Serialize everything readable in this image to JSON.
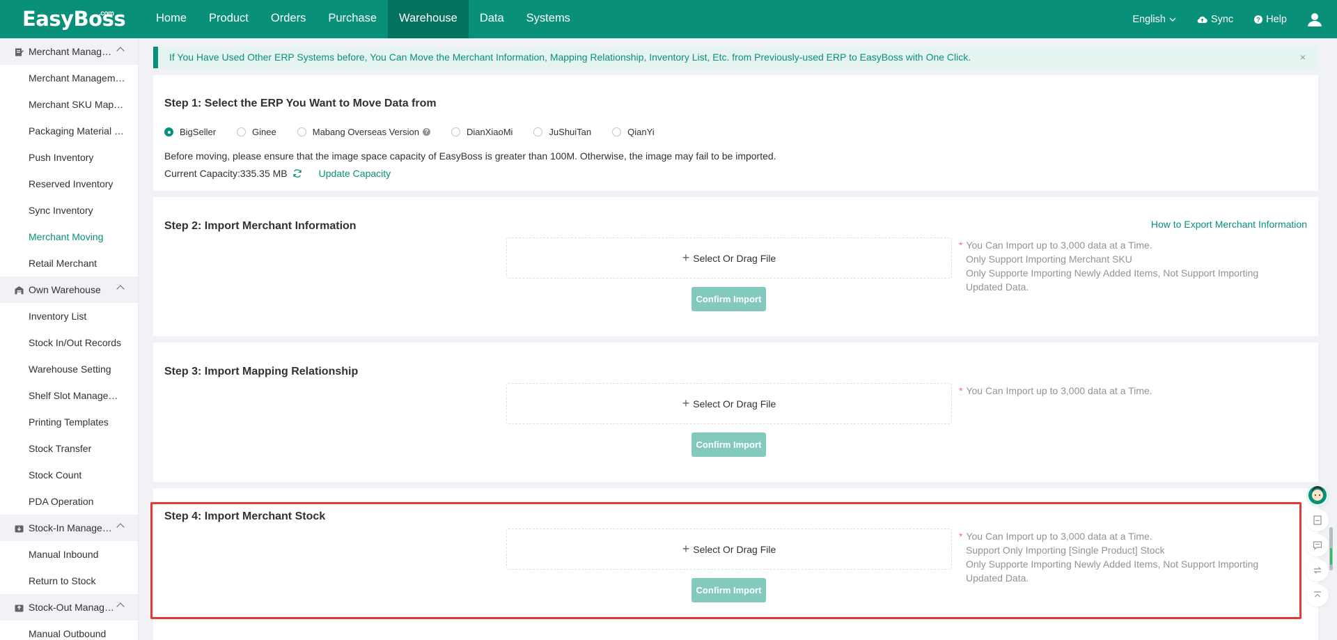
{
  "header": {
    "logo": "EasyBoss",
    "logo_suffix": ".com",
    "nav": [
      {
        "label": "Home"
      },
      {
        "label": "Product"
      },
      {
        "label": "Orders"
      },
      {
        "label": "Purchase"
      },
      {
        "label": "Warehouse",
        "active": true
      },
      {
        "label": "Data"
      },
      {
        "label": "Systems"
      }
    ],
    "language": "English",
    "sync": "Sync",
    "help": "Help"
  },
  "sidebar": {
    "groups": [
      {
        "label": "Merchant Management",
        "items": [
          "Merchant Management",
          "Merchant SKU Mapping",
          "Packaging Material Management",
          "Push Inventory",
          "Reserved Inventory",
          "Sync Inventory",
          "Merchant Moving",
          "Retail Merchant"
        ]
      },
      {
        "label": "Own Warehouse",
        "items": [
          "Inventory List",
          "Stock In/Out Records",
          "Warehouse Setting",
          "Shelf Slot Management",
          "Printing Templates",
          "Stock Transfer",
          "Stock Count",
          "PDA Operation"
        ]
      },
      {
        "label": "Stock-In Management",
        "items": [
          "Manual Inbound",
          "Return to Stock"
        ]
      },
      {
        "label": "Stock-Out Management",
        "items": [
          "Manual Outbound"
        ]
      }
    ],
    "active_item": "Merchant Moving"
  },
  "notice": {
    "text": "If You Have Used Other ERP Systems before, You Can Move the Merchant Information, Mapping Relationship, Inventory List, Etc. from Previously-used ERP to EasyBoss with One Click.",
    "close": "×"
  },
  "step1": {
    "title": "Step 1: Select the ERP You Want to Move Data from",
    "options": [
      {
        "label": "BigSeller",
        "checked": true
      },
      {
        "label": "Ginee"
      },
      {
        "label": "Mabang Overseas Version",
        "help": "?"
      },
      {
        "label": "DianXiaoMi"
      },
      {
        "label": "JuShuiTan"
      },
      {
        "label": "QianYi"
      }
    ],
    "warning": "Before moving, please ensure that the image space capacity of EasyBoss is greater than 100M. Otherwise, the image may fail to be imported.",
    "capacity_label": "Current Capacity:335.35 MB",
    "update_capacity": "Update Capacity"
  },
  "step2": {
    "title": "Step 2: Import Merchant Information",
    "help_link": "How to Export Merchant Information",
    "dropzone": "Select Or Drag File",
    "confirm": "Confirm Import",
    "notes": [
      "You Can Import up to 3,000 data at a Time.",
      "Only Support Importing Merchant SKU",
      "Only Supporte Importing Newly Added Items, Not Support Importing Updated Data."
    ]
  },
  "step3": {
    "title": "Step 3: Import Mapping Relationship",
    "dropzone": "Select Or Drag File",
    "confirm": "Confirm Import",
    "notes": [
      "You Can Import up to 3,000 data at a Time."
    ]
  },
  "step4": {
    "title": "Step 4: Import Merchant Stock",
    "dropzone": "Select Or Drag File",
    "confirm": "Confirm Import",
    "notes": [
      "You Can Import up to 3,000 data at a Time.",
      "Support Only Importing [Single Product] Stock",
      "Only Supporte Importing Newly Added Items, Not Support Importing Updated Data."
    ]
  },
  "colors": {
    "brand": "#08907a",
    "brand_dark": "#05725f",
    "highlight": "#e53935",
    "disabled_button": "#84c9bd"
  }
}
